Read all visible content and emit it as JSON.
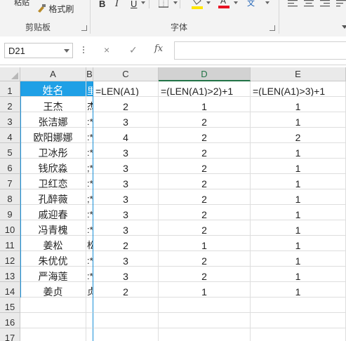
{
  "ribbon": {
    "paste_label": "粘贴",
    "format_painter_label": "格式刷",
    "clipboard_group": "剪贴板",
    "font_group": "字体",
    "bold": "B",
    "italic": "I",
    "underline": "U",
    "wen_label": "文"
  },
  "formula_bar": {
    "name_box": "D21",
    "cancel_icon": "×",
    "enter_icon": "✓",
    "fx_label": "fx",
    "formula": ""
  },
  "columns": [
    "A",
    "B",
    "C",
    "D",
    "E"
  ],
  "rows": [
    "1",
    "2",
    "3",
    "4",
    "5",
    "6",
    "7",
    "8",
    "9",
    "10",
    "11",
    "12",
    "13",
    "14",
    "15",
    "16",
    "17"
  ],
  "header_row": {
    "a": "姓名",
    "b": "里",
    "c": "=LEN(A1)",
    "d": "=(LEN(A1)>2)+1",
    "e": "=(LEN(A1)>3)+1"
  },
  "data_rows": [
    {
      "name": "王杰",
      "b": "杰",
      "c": "2",
      "d": "1",
      "e": "1"
    },
    {
      "name": "张洁娜",
      "b": ":*",
      "c": "3",
      "d": "2",
      "e": "1"
    },
    {
      "name": "欧阳娜娜",
      "b": ":*",
      "c": "4",
      "d": "2",
      "e": "2"
    },
    {
      "name": "卫冰彤",
      "b": ":*",
      "c": "3",
      "d": "2",
      "e": "1"
    },
    {
      "name": "钱欣淼",
      "b": ";*",
      "c": "3",
      "d": "2",
      "e": "1"
    },
    {
      "name": "卫红恋",
      "b": ":*",
      "c": "3",
      "d": "2",
      "e": "1"
    },
    {
      "name": "孔醉薇",
      "b": ";*",
      "c": "3",
      "d": "2",
      "e": "1"
    },
    {
      "name": "戚迎春",
      "b": ":*",
      "c": "3",
      "d": "2",
      "e": "1"
    },
    {
      "name": "冯青槐",
      "b": ":*",
      "c": "3",
      "d": "2",
      "e": "1"
    },
    {
      "name": "姜松",
      "b": "松",
      "c": "2",
      "d": "1",
      "e": "1"
    },
    {
      "name": "朱优优",
      "b": ":*",
      "c": "3",
      "d": "2",
      "e": "1"
    },
    {
      "name": "严海莲",
      "b": ":*",
      "c": "3",
      "d": "2",
      "e": "1"
    },
    {
      "name": "姜贞",
      "b": "贞",
      "c": "2",
      "d": "1",
      "e": "1"
    }
  ],
  "colors": {
    "header_fill": "#1fa0e6",
    "excel_green": "#217346",
    "font_color_red": "#e81123",
    "highlight_yellow": "#ffe600"
  }
}
